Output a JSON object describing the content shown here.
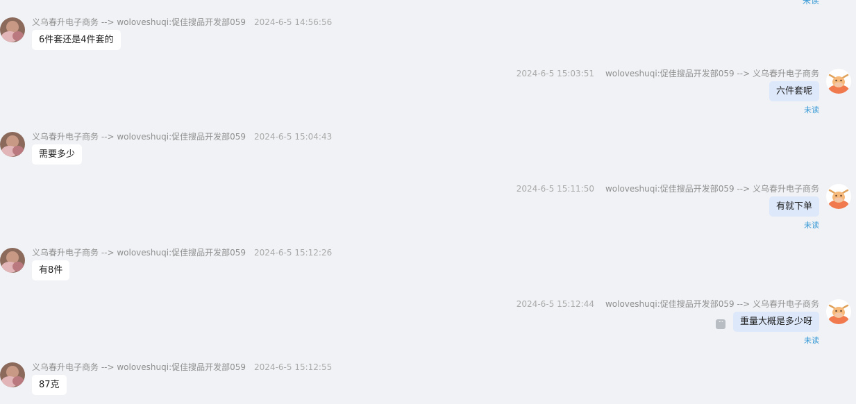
{
  "colors": {
    "background": "#f0f2f5",
    "left_bubble": "#ffffff",
    "right_bubble": "#dde8fb",
    "unread": "#3a9bd7",
    "meta_text": "#8f8f8f"
  },
  "top_partial_status": "未读",
  "messages": [
    {
      "side": "left",
      "meta": "义乌春升电子商务 --> woloveshuqi:促佳搜品开发部059",
      "time": "2024-6-5 14:56:56",
      "text": "6件套还是4件套的",
      "avatar": "photo-avatar"
    },
    {
      "side": "right",
      "meta": "woloveshuqi:促佳搜品开发部059 --> 义乌春升电子商务",
      "time": "2024-6-5 15:03:51",
      "text": "六件套呢",
      "status": "未读",
      "avatar": "cow-avatar"
    },
    {
      "side": "left",
      "meta": "义乌春升电子商务 --> woloveshuqi:促佳搜品开发部059",
      "time": "2024-6-5 15:04:43",
      "text": "需要多少",
      "avatar": "photo-avatar"
    },
    {
      "side": "right",
      "meta": "woloveshuqi:促佳搜品开发部059 --> 义乌春升电子商务",
      "time": "2024-6-5 15:11:50",
      "text": "有就下单",
      "status": "未读",
      "avatar": "cow-avatar"
    },
    {
      "side": "left",
      "meta": "义乌春升电子商务 --> woloveshuqi:促佳搜品开发部059",
      "time": "2024-6-5 15:12:26",
      "text": "有8件",
      "avatar": "photo-avatar"
    },
    {
      "side": "right",
      "meta": "woloveshuqi:促佳搜品开发部059 --> 义乌春升电子商务",
      "time": "2024-6-5 15:12:44",
      "text": "重量大概是多少呀",
      "status": "未读",
      "avatar": "cow-avatar",
      "has_more_icon": true
    },
    {
      "side": "left",
      "meta": "义乌春升电子商务 --> woloveshuqi:促佳搜品开发部059",
      "time": "2024-6-5 15:12:55",
      "text": "87克",
      "avatar": "photo-avatar"
    }
  ]
}
